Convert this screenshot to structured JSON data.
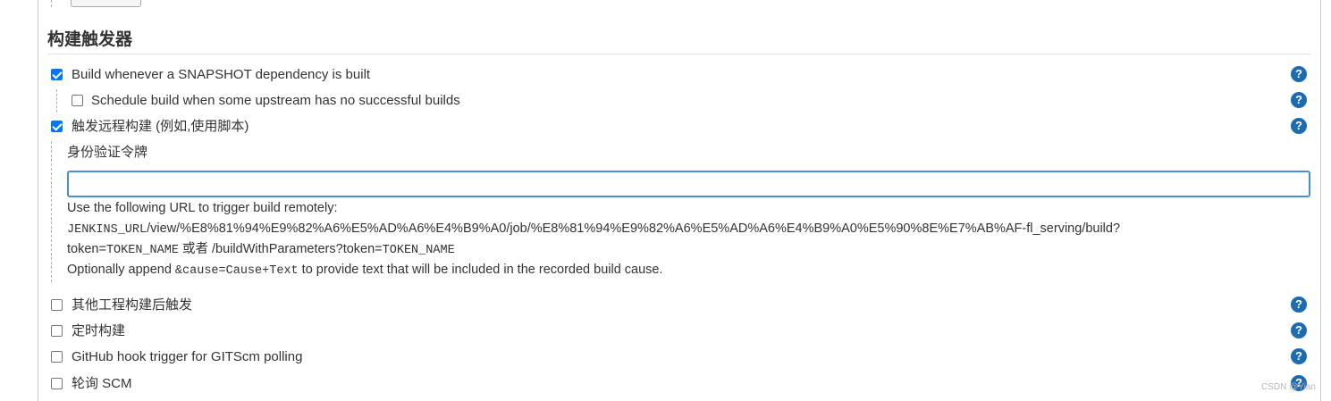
{
  "section": {
    "title": "构建触发器"
  },
  "triggers": {
    "snapshot": {
      "label": "Build whenever a SNAPSHOT dependency is built",
      "checked": true
    },
    "upstream": {
      "label": "Schedule build when some upstream has no successful builds",
      "checked": false
    },
    "remote": {
      "label": "触发远程构建 (例如,使用脚本)",
      "checked": true
    },
    "other_project": {
      "label": "其他工程构建后触发",
      "checked": false
    },
    "periodic": {
      "label": "定时构建",
      "checked": false
    },
    "github_hook": {
      "label": "GitHub hook trigger for GITScm polling",
      "checked": false
    },
    "poll_scm": {
      "label": "轮询 SCM",
      "checked": false
    }
  },
  "auth_token": {
    "label": "身份验证令牌",
    "value": ""
  },
  "remote_help": {
    "intro": "Use the following URL to trigger build remotely:",
    "url_var": "JENKINS_URL",
    "url_path": "/view/%E8%81%94%E9%82%A6%E5%AD%A6%E4%B9%A0/job/%E8%81%94%E9%82%A6%E5%AD%A6%E4%B9%A0%E5%90%8E%E7%AB%AF-fl_serving/build?",
    "token_key": "token=",
    "token_var_1": "TOKEN_NAME",
    "or_text": " 或者 ",
    "with_params": "/buildWithParameters?token=",
    "token_var_2": "TOKEN_NAME",
    "append_prefix": "Optionally append ",
    "append_code": "&cause=Cause+Text",
    "append_suffix": " to provide text that will be included in the recorded build cause."
  },
  "help_icon_glyph": "?",
  "icons": {
    "help": "help-icon"
  },
  "colors": {
    "help_icon": "#1d6bb0",
    "checkbox_checked": "#0075ff",
    "input_focus_border": "#4b8dd4"
  },
  "watermark": "CSDN @Yian"
}
